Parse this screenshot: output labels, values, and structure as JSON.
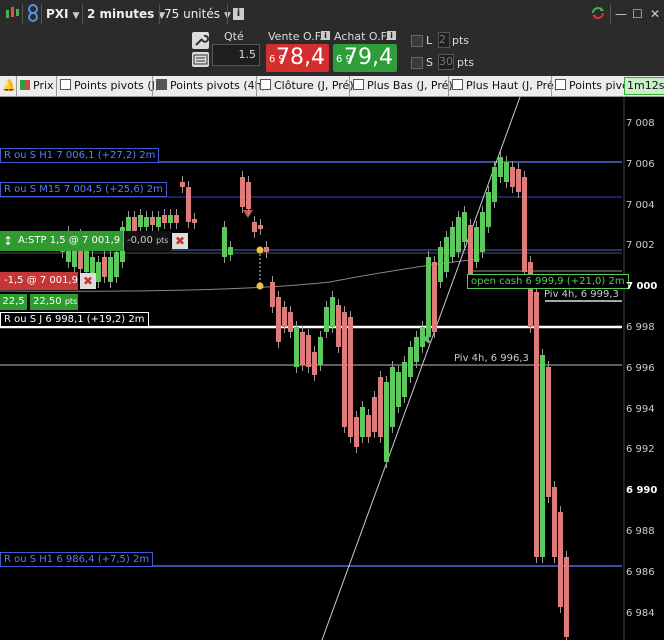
{
  "topbar": {
    "symbol": "PXI",
    "timeframe": "2 minutes",
    "units": "75 unités",
    "info": "i"
  },
  "order": {
    "qty_label": "Qté",
    "qty_value": "1.5",
    "sell_label": "Vente O.F.",
    "sell_prefix": "6 9",
    "sell_price": "78,4",
    "buy_label": "Achat O.F.",
    "buy_prefix": "6 9",
    "buy_price": "79,4",
    "l_label": "L",
    "l_value": "2",
    "s_label": "S",
    "s_value": "30",
    "pts1": "pts",
    "pts2": "pts"
  },
  "indicators": {
    "prix": "Prix",
    "pp_j": "Points pivots (J)",
    "pp_4h": "Points pivots (4h)",
    "cloture": "Clôture (J, Pré)",
    "plus_bas": "Plus Bas (J, Pré)",
    "plus_haut": "Plus Haut (J, Pré)",
    "points_piv": "Points pivo",
    "timeframe_badge": "1m12s"
  },
  "levels": {
    "r_s_h1_top": "R ou S H1 7 006,1 (+27,2) 2m",
    "r_s_m15": "R ou S M15 7 004,5 (+25,6) 2m",
    "r_s_j": "R ou S J 6 998,1 (+19,2) 2m",
    "r_s_h1_bot": "R ou S H1 6 986,4 (+7,5) 2m",
    "piv_4h_a": "Piv 4h, 6 999,3",
    "piv_4h_b": "Piv 4h, 6 996,3",
    "open_cash": "open cash 6 999,9 (+21,0) 2m"
  },
  "positions": {
    "stop_label": "A:STP 1,5 @ 7 001,9",
    "stop_pts": "-0,00",
    "stop_pts_unit": "pts",
    "pos_label": "-1,5 @ 7 001,9",
    "pnl_a": "22,5",
    "pnl_b": "22,50",
    "pnl_unit": "pts"
  },
  "yaxis": {
    "ticks": [
      "7 008",
      "7 006",
      "7 004",
      "7 002",
      "7 000",
      "6 998",
      "6 996",
      "6 994",
      "6 992",
      "6 990",
      "6 988",
      "6 986",
      "6 984"
    ],
    "bold": [
      "7 000",
      "6 990"
    ]
  },
  "colors": {
    "up": "#5cc95c",
    "down": "#e07b7b",
    "level_blue": "#5b7dff",
    "sell_red": "#d32f2f",
    "buy_green": "#2e9d3a"
  }
}
